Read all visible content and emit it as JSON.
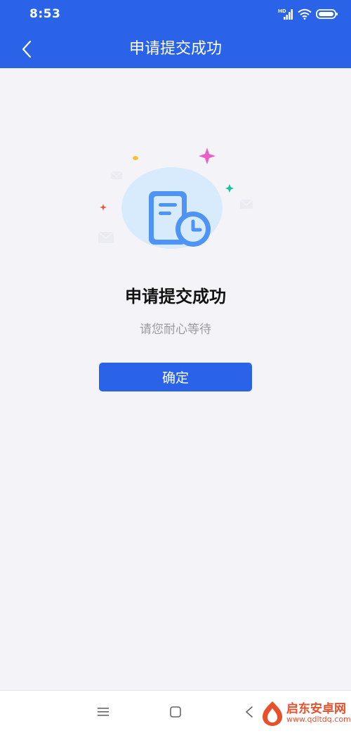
{
  "status_bar": {
    "time": "8:53",
    "network_label": "HD",
    "icons": [
      "signal-icon",
      "wifi-icon",
      "battery-icon"
    ]
  },
  "header": {
    "back_icon": "chevron-left-icon",
    "title": "申请提交成功"
  },
  "result": {
    "illustration_icon": "document-clock-icon",
    "title": "申请提交成功",
    "subtitle": "请您耐心等待",
    "confirm_label": "确定"
  },
  "nav_bar": {
    "icons": [
      "menu-icon",
      "home-square-icon",
      "back-triangle-icon"
    ]
  },
  "watermark": {
    "name": "启东安卓网",
    "url": "www.qdltdq.com"
  },
  "colors": {
    "primary": "#2a63e8",
    "background": "#f4f4f8",
    "subtitle_text": "#9a9aa0",
    "watermark": "#e8502c"
  }
}
